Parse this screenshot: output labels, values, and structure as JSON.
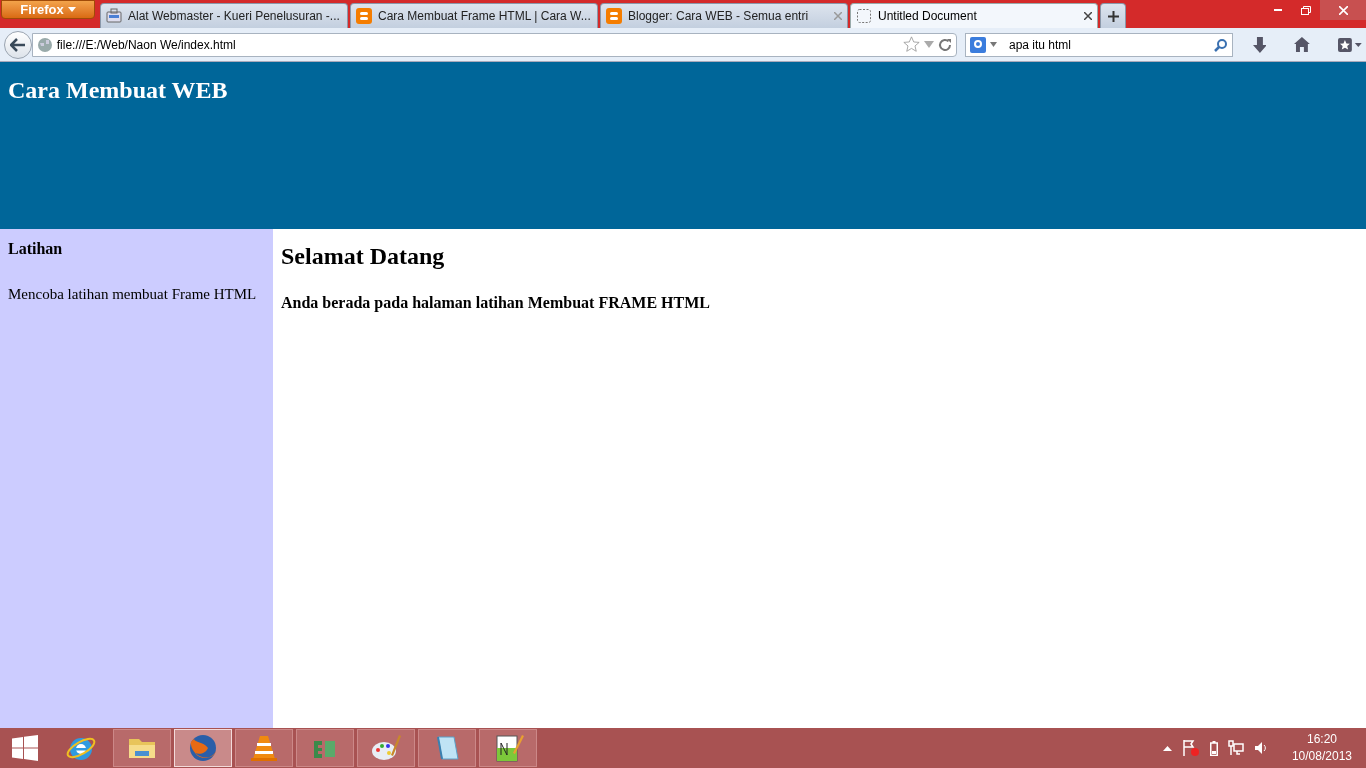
{
  "browser": {
    "menu_button": "Firefox",
    "tabs": [
      {
        "title": "Alat Webmaster - Kueri Penelusuran -...",
        "selected": false,
        "kind": "webmaster"
      },
      {
        "title": "Cara Membuat Frame HTML | Cara W...",
        "selected": false,
        "kind": "blogger"
      },
      {
        "title": "Blogger: Cara WEB - Semua entri",
        "selected": false,
        "kind": "blogger"
      },
      {
        "title": "Untitled Document",
        "selected": true,
        "kind": "blank"
      }
    ],
    "url": "file:///E:/Web/Naon We/index.html",
    "search": "apa itu html"
  },
  "page": {
    "header_title": "Cara Membuat WEB",
    "sidebar": {
      "heading": "Latihan",
      "text": "Mencoba latihan membuat Frame HTML"
    },
    "main": {
      "heading": "Selamat Datang",
      "text": "Anda berada pada halaman latihan Membuat FRAME HTML"
    }
  },
  "taskbar": {
    "apps": [
      {
        "kind": "ie",
        "active": false
      },
      {
        "kind": "explorer",
        "active": false
      },
      {
        "kind": "firefox",
        "active": true
      },
      {
        "kind": "vlc",
        "active": false
      },
      {
        "kind": "esia",
        "active": false
      },
      {
        "kind": "paint",
        "active": false
      },
      {
        "kind": "notepad",
        "active": false
      },
      {
        "kind": "notepadpp",
        "active": false
      }
    ],
    "time": "16:20",
    "date": "10/08/2013"
  }
}
